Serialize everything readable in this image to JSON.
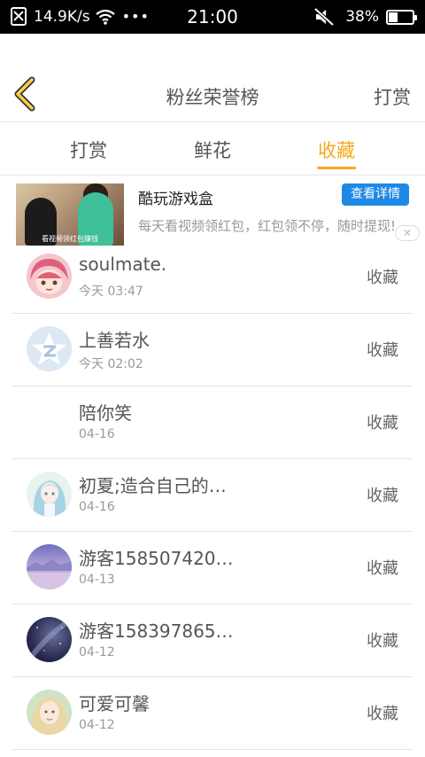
{
  "status_bar": {
    "speed": "14.9K/s",
    "more": "•••",
    "time": "21:00",
    "battery": "38%",
    "battery_level": 0.38
  },
  "header": {
    "title": "粉丝荣誉榜",
    "right_link": "打赏"
  },
  "tabs": [
    {
      "label": "打赏",
      "active": false
    },
    {
      "label": "鲜花",
      "active": false
    },
    {
      "label": "收藏",
      "active": true
    }
  ],
  "ad": {
    "title": "酷玩游戏盒",
    "cta": "查看详情",
    "description": "每天看视频领红包，红包领不停，随时提现!",
    "thumb_caption": "看视频领红包赚钱"
  },
  "rows": [
    {
      "name": "soulmate.",
      "time": "今天 03:47",
      "status": "收藏",
      "avatar": "anime-pink-hair"
    },
    {
      "name": "上善若水",
      "time": "今天 02:02",
      "status": "收藏",
      "avatar": "default-star"
    },
    {
      "name": "陪你笑",
      "time": "04-16",
      "status": "收藏",
      "avatar": "none"
    },
    {
      "name": "初夏;造合自己的…",
      "time": "04-16",
      "status": "收藏",
      "avatar": "anime-blue-girl"
    },
    {
      "name": "游客158507420…",
      "time": "04-13",
      "status": "收藏",
      "avatar": "purple-landscape"
    },
    {
      "name": "游客158397865…",
      "time": "04-12",
      "status": "收藏",
      "avatar": "night-sky"
    },
    {
      "name": "可爱可馨",
      "time": "04-12",
      "status": "收藏",
      "avatar": "girl-portrait"
    }
  ],
  "colors": {
    "accent": "#f7a81b",
    "cta_blue": "#1e88e5",
    "status_bar": "#000000"
  }
}
